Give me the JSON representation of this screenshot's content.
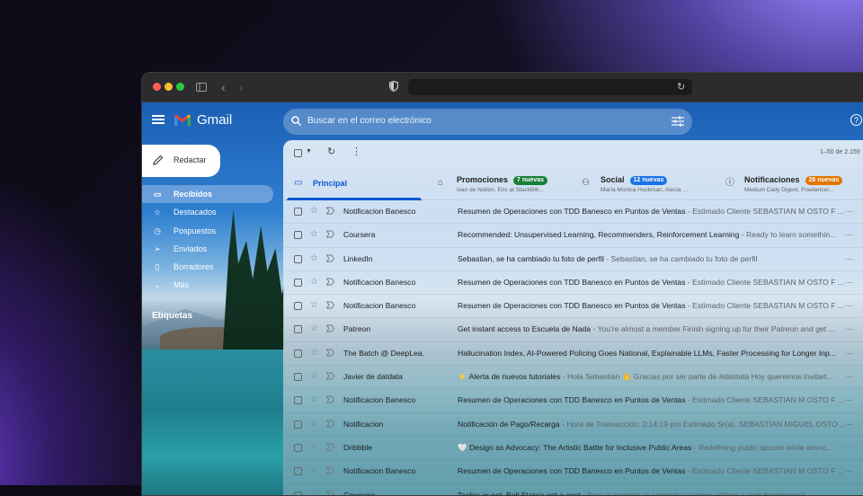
{
  "browser": {
    "back_icon": "chevron-left-icon",
    "forward_icon": "chevron-right-icon",
    "sidebar_icon": "sidebar-icon"
  },
  "app": {
    "name": "Gmail"
  },
  "search": {
    "placeholder": "Buscar en el correo electrónico"
  },
  "compose": {
    "label": "Redactar"
  },
  "sidebar": {
    "items": [
      {
        "label": "Recibidos",
        "icon": "inbox-icon",
        "active": true
      },
      {
        "label": "Destacados",
        "icon": "star-icon"
      },
      {
        "label": "Pospuestos",
        "icon": "clock-icon"
      },
      {
        "label": "Enviados",
        "icon": "send-icon"
      },
      {
        "label": "Borradores",
        "icon": "draft-icon"
      },
      {
        "label": "Más",
        "icon": "chevron-down-icon"
      }
    ],
    "labels_heading": "Etiquetas"
  },
  "toolbar": {
    "pagination": "1–50 de 2.159"
  },
  "tabs": [
    {
      "label": "Principal",
      "icon": "inbox-icon",
      "active": true,
      "badge": "",
      "sub": ""
    },
    {
      "label": "Promociones",
      "icon": "tag-icon",
      "badge": "7 nuevas",
      "badge_color": "#188038",
      "sub": "Ivan de Notion, Eric at StackBlit..."
    },
    {
      "label": "Social",
      "icon": "people-icon",
      "badge": "12 nuevas",
      "badge_color": "#1a73e8",
      "sub": "María Monica Hockman, Alecia ..."
    },
    {
      "label": "Notificaciones",
      "icon": "info-icon",
      "badge": "26 nuevas",
      "badge_color": "#e37400",
      "sub": "Medium Daily Digest, Freelancer..."
    }
  ],
  "emails": [
    {
      "sender": "Notificacion Banesco",
      "subject": "Resumen de Operaciones con TDD Banesco en Puntos de Ventas",
      "snippet": " - Estimado Cliente SEBASTIAN M OSTO F ..."
    },
    {
      "sender": "Coursera",
      "subject": "Recommended: Unsupervised Learning, Recommenders, Reinforcement Learning",
      "snippet": " - Ready to learn somethin..."
    },
    {
      "sender": "LinkedIn",
      "subject": "Sebastian, se ha cambiado tu foto de perfil",
      "snippet": " - Sebastian, se ha cambiado tu foto de perfil"
    },
    {
      "sender": "Notificacion Banesco",
      "subject": "Resumen de Operaciones con TDD Banesco en Puntos de Ventas",
      "snippet": " - Estimado Cliente SEBASTIAN M OSTO F ..."
    },
    {
      "sender": "Notificacion Banesco",
      "subject": "Resumen de Operaciones con TDD Banesco en Puntos de Ventas",
      "snippet": " - Estimado Cliente SEBASTIAN M OSTO F ..."
    },
    {
      "sender": "Patreon",
      "subject": "Get instant access to Escuela de Nada",
      "snippet": " - You're almost a member Finish signing up for their Patreon and get ..."
    },
    {
      "sender": "The Batch @ DeepLea.",
      "subject": "Hallucination Index, AI-Powered Policing Goes National, Explainable LLMs, Faster Processing for Longer Inp...",
      "snippet": ""
    },
    {
      "sender": "Javier de datdata",
      "subject": "⚡ Alerta de nuevos tutoriales",
      "snippet": " - Hola Sebastian 👋 Gracias por ser parte de #datdata Hoy queremos invitart..."
    },
    {
      "sender": "Notificacion Banesco",
      "subject": "Resumen de Operaciones con TDD Banesco en Puntos de Ventas",
      "snippet": " - Estimado Cliente SEBASTIAN M OSTO F ..."
    },
    {
      "sender": "Notificacion",
      "subject": "Notificación de Pago/Recarga",
      "snippet": " - Hora de Transacción: 2:14:19 pm Estimado Sr(a). SEBASTIAN MIGUEL OSTO ..."
    },
    {
      "sender": "Dribbble",
      "subject": "🤍 Design as Advocacy: The Artistic Battle for Inclusive Public Areas",
      "snippet": " - Redefining public spaces while advoc..."
    },
    {
      "sender": "Notificacion Banesco",
      "subject": "Resumen de Operaciones con TDD Banesco en Puntos de Ventas",
      "snippet": " - Estimado Cliente SEBASTIAN M OSTO F ..."
    },
    {
      "sender": "Coursera",
      "subject": "Techie or not, Ball State's got a spot",
      "snippet": " - Earn a master's in computer science without a tech background"
    }
  ]
}
